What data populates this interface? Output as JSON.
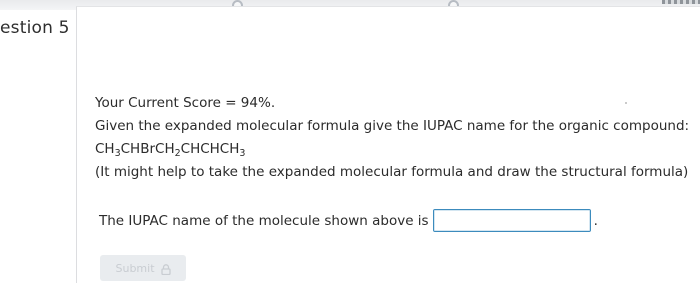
{
  "question": {
    "label": "estion 5"
  },
  "content": {
    "score_line": "Your Current Score = 94%.",
    "prompt_line": "Given the expanded molecular formula give the IUPAC name for the organic compound:",
    "formula": {
      "parts": [
        "CH",
        "3",
        "CHBrCH",
        "2",
        "CHCHCH",
        "3"
      ]
    },
    "hint_line": "(It might help to take the expanded molecular formula and draw the structural formula)"
  },
  "answer": {
    "label": "The IUPAC name of the molecule shown above is",
    "value": "",
    "period": "."
  },
  "submit": {
    "label": "Submit",
    "icon": "lock-icon"
  },
  "colors": {
    "input_border": "#3c8bbd",
    "submit_bg": "#e9ecef",
    "text": "#2b2b2b"
  }
}
